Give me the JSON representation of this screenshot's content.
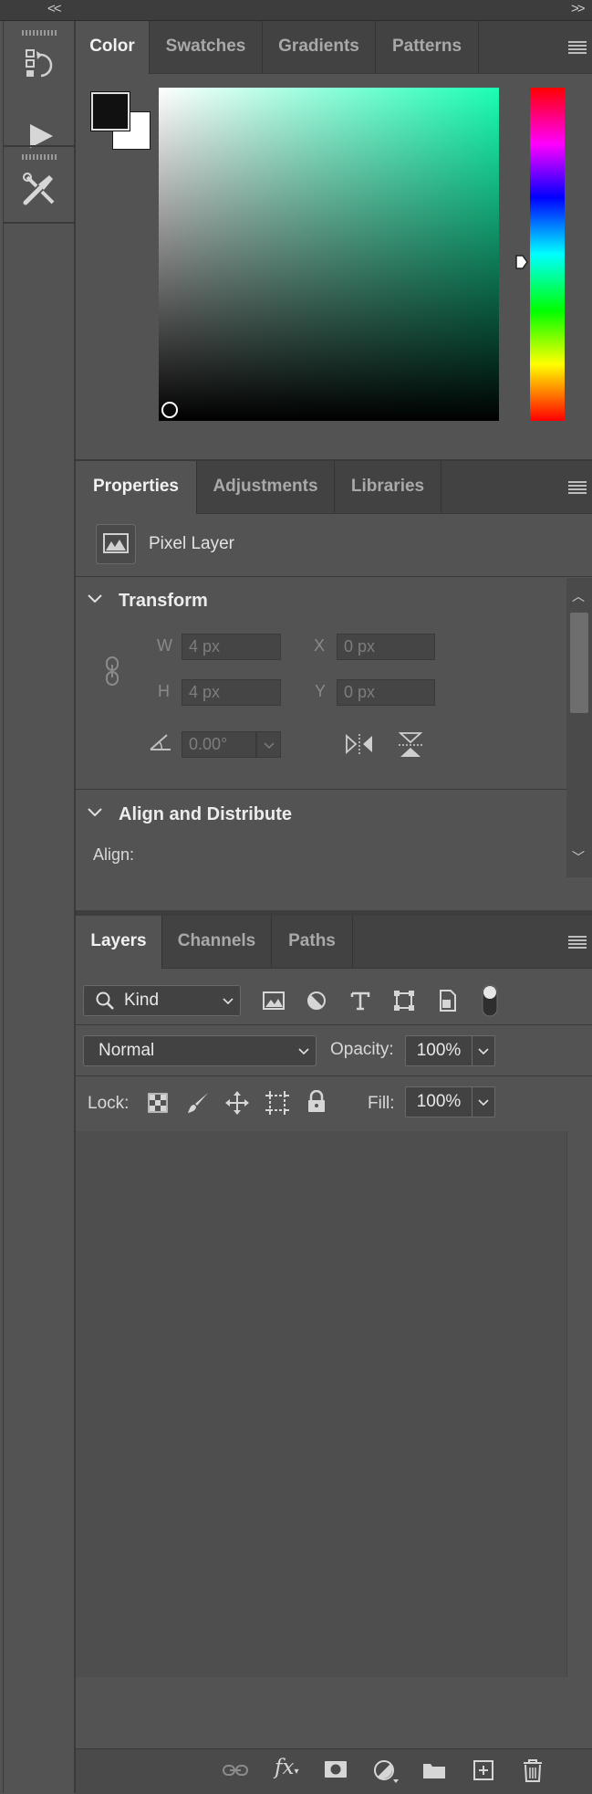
{
  "top_strip": {
    "collapse_left": "<<",
    "collapse_right": ">>"
  },
  "color_panel": {
    "tabs": [
      "Color",
      "Swatches",
      "Gradients",
      "Patterns"
    ],
    "active_tab": "Color",
    "foreground_color": "#111111",
    "background_color": "#ffffff",
    "hue_color": "#1affb4"
  },
  "properties_panel": {
    "tabs": [
      "Properties",
      "Adjustments",
      "Libraries"
    ],
    "active_tab": "Properties",
    "layer_type": "Pixel Layer",
    "transform": {
      "title": "Transform",
      "w_label": "W",
      "w_value": "4 px",
      "h_label": "H",
      "h_value": "4 px",
      "x_label": "X",
      "x_value": "0 px",
      "y_label": "Y",
      "y_value": "0 px",
      "angle_value": "0.00°"
    },
    "align": {
      "title": "Align and Distribute",
      "align_label": "Align:"
    }
  },
  "layers_panel": {
    "tabs": [
      "Layers",
      "Channels",
      "Paths"
    ],
    "active_tab": "Layers",
    "filter_kind": "Kind",
    "blend_mode": "Normal",
    "opacity_label": "Opacity:",
    "opacity_value": "100%",
    "lock_label": "Lock:",
    "fill_label": "Fill:",
    "fill_value": "100%",
    "fx_label": "fx"
  }
}
